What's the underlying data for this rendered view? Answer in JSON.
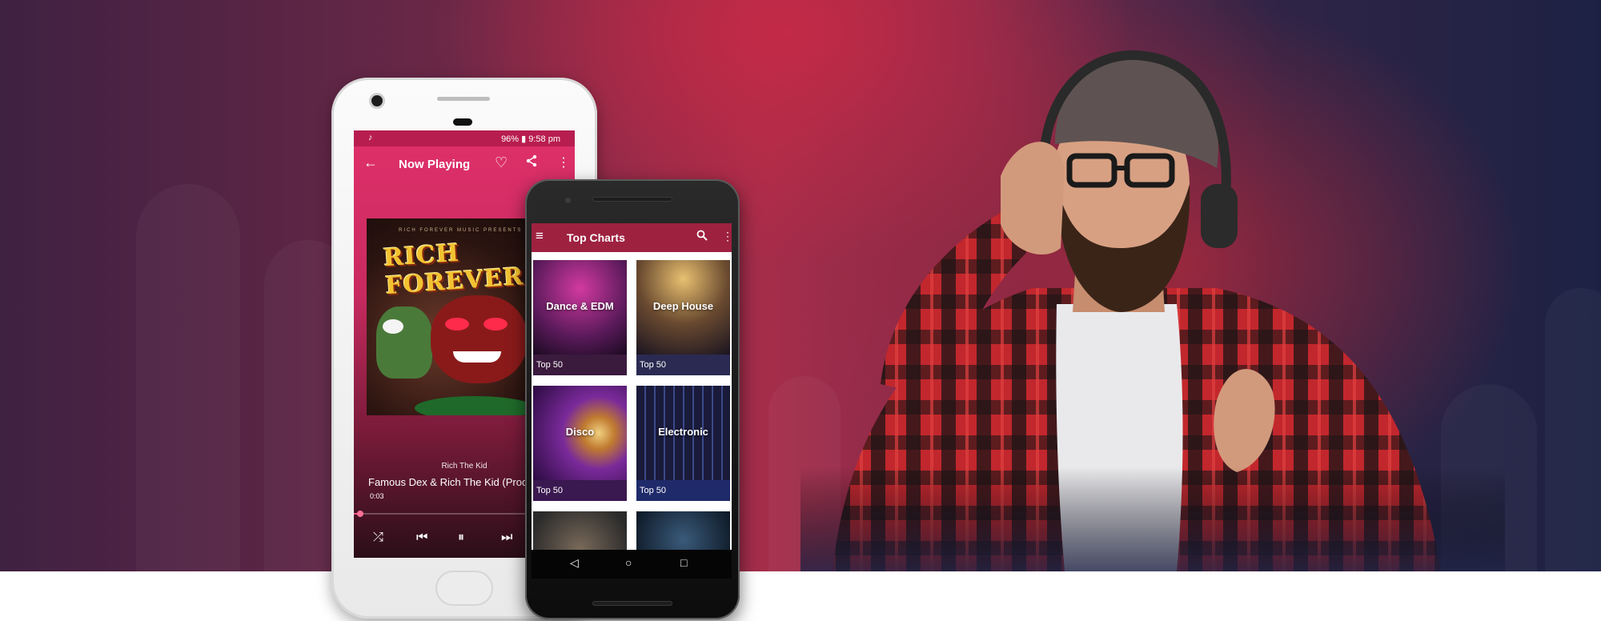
{
  "now_playing_phone": {
    "status_bar": {
      "music_note_icon": "music-note-icon",
      "indicators_text": "96% ▮ 9:58 pm"
    },
    "app_bar": {
      "title": "Now Playing"
    },
    "album_art": {
      "title_text": "RICH FOREVER",
      "publisher_text": "RICH FOREVER MUSIC PRESENTS"
    },
    "artist": "Rich The Kid",
    "track_title": "Famous Dex & Rich The Kid (Prod By",
    "elapsed_time": "0:03",
    "progress_fraction": 0.03,
    "controls": [
      "shuffle",
      "previous",
      "pause",
      "next"
    ]
  },
  "charts_phone": {
    "app_bar": {
      "title": "Top Charts"
    },
    "tiles": [
      {
        "name": "Dance & EDM",
        "subtitle": "Top 50",
        "bar_color": "#3a1a3d"
      },
      {
        "name": "Deep House",
        "subtitle": "Top 50",
        "bar_color": "#2a2a52"
      },
      {
        "name": "Disco",
        "subtitle": "Top 50",
        "bar_color": "#3a1850"
      },
      {
        "name": "Electronic",
        "subtitle": "Top 50",
        "bar_color": "#1f2a6a"
      },
      {
        "name": "",
        "subtitle": "",
        "bar_color": "#2a2a2a"
      },
      {
        "name": "",
        "subtitle": "",
        "bar_color": "#1a2a3a"
      }
    ],
    "nav_bar": [
      "back",
      "home",
      "recents"
    ]
  },
  "colors": {
    "now_playing_accent": "#e0306a",
    "charts_app_bar": "#9e2140",
    "banner_red": "#c42a46",
    "banner_navy": "#1d2244"
  }
}
